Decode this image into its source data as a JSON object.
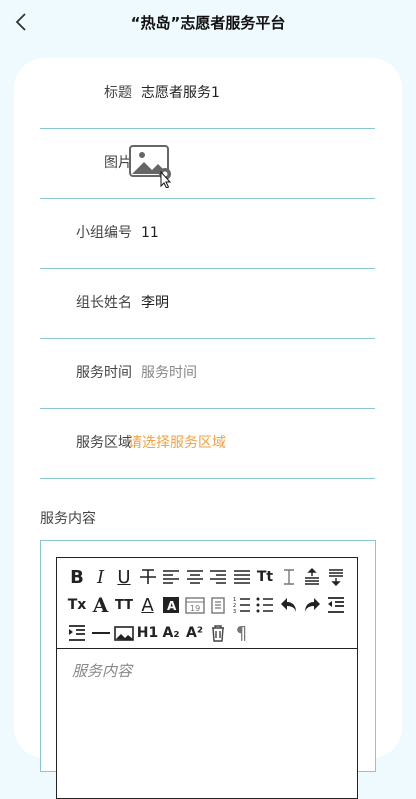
{
  "header": {
    "title": "“热岛”志愿者服务平台"
  },
  "form": {
    "title_label": "标题",
    "title_value": "志愿者服务1",
    "image_label": "图片",
    "group_label": "小组编号",
    "group_value": "11",
    "leader_label": "组长姓名",
    "leader_value": "李明",
    "time_label": "服务时间",
    "time_placeholder": "服务时间",
    "area_label": "服务区域",
    "area_action": "请选择服务区域",
    "content_label": "服务内容"
  },
  "editor": {
    "placeholder": "服务内容",
    "tools": [
      {
        "icon": "bold-icon",
        "glyph": "B"
      },
      {
        "icon": "italic-icon",
        "glyph": "I"
      },
      {
        "icon": "underline-icon",
        "glyph": "U"
      },
      {
        "icon": "strikethrough-icon",
        "glyph": "T"
      },
      {
        "icon": "align-left-icon"
      },
      {
        "icon": "align-center-icon"
      },
      {
        "icon": "align-right-icon"
      },
      {
        "icon": "align-justify-icon"
      },
      {
        "icon": "font-size-icon",
        "glyph": "Tt"
      },
      {
        "icon": "line-height-icon"
      },
      {
        "icon": "space-before-icon"
      },
      {
        "icon": "space-after-icon"
      },
      {
        "icon": "clear-format-icon",
        "glyph": "Tx"
      },
      {
        "icon": "font-icon",
        "glyph": "A"
      },
      {
        "icon": "font-size-small-icon",
        "glyph": "TT"
      },
      {
        "icon": "font-color-icon",
        "glyph": "A"
      },
      {
        "icon": "background-color-icon",
        "glyph": "A"
      },
      {
        "icon": "date-icon",
        "glyph": "19"
      },
      {
        "icon": "clipboard-icon"
      },
      {
        "icon": "ordered-list-icon"
      },
      {
        "icon": "unordered-list-icon"
      },
      {
        "icon": "undo-icon"
      },
      {
        "icon": "redo-icon"
      },
      {
        "icon": "outdent-icon"
      },
      {
        "icon": "indent-icon"
      },
      {
        "icon": "horizontal-rule-icon"
      },
      {
        "icon": "insert-image-icon"
      },
      {
        "icon": "heading-icon",
        "glyph": "H1"
      },
      {
        "icon": "subscript-icon",
        "glyph": "A₂"
      },
      {
        "icon": "superscript-icon",
        "glyph": "A²"
      },
      {
        "icon": "delete-icon"
      },
      {
        "icon": "paragraph-icon",
        "glyph": "¶"
      }
    ]
  },
  "colors": {
    "background": "#eefafd",
    "divider": "#8cc6d3",
    "accent_orange": "#f0a347"
  }
}
